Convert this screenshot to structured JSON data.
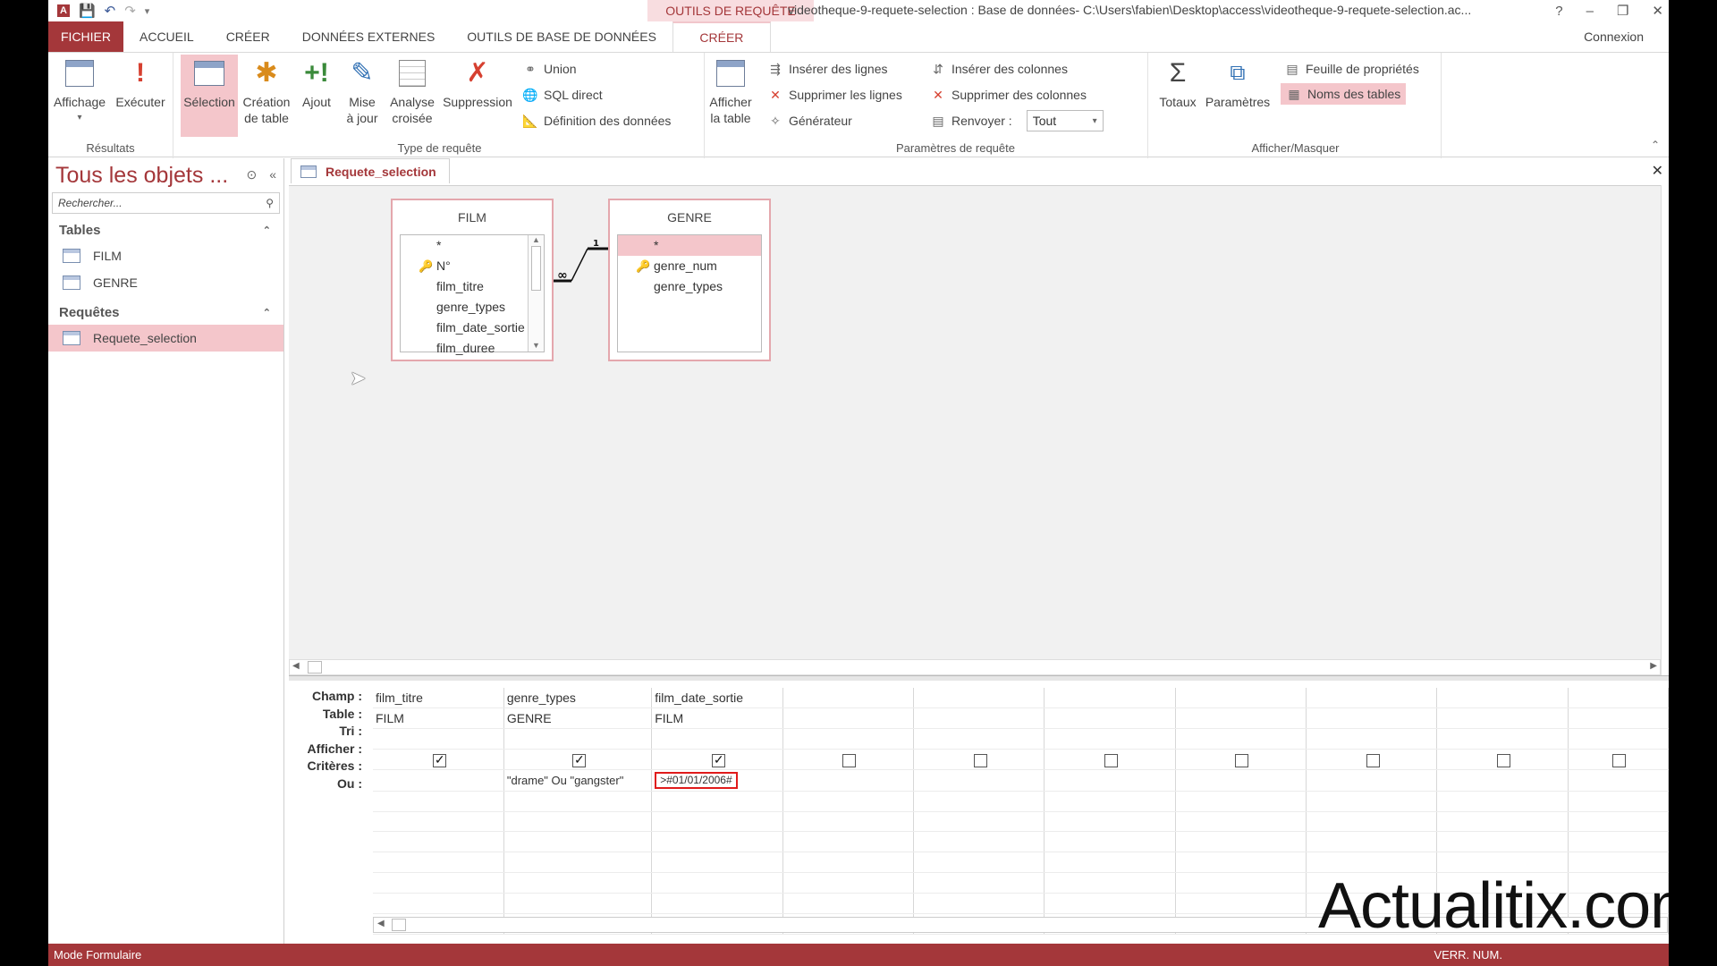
{
  "titlebar": {
    "context_title": "OUTILS DE REQUÊTE",
    "doc_title": "videotheque-9-requete-selection : Base de données- C:\\Users\\fabien\\Desktop\\access\\videotheque-9-requete-selection.ac...",
    "help": "?",
    "minimize": "–",
    "restore": "❐",
    "close": "✕"
  },
  "tabs": {
    "file": "FICHIER",
    "home": "ACCUEIL",
    "create": "CRÉER",
    "external": "DONNÉES EXTERNES",
    "dbtools": "OUTILS DE BASE DE DONNÉES",
    "ctx_create": "CRÉER",
    "connexion": "Connexion"
  },
  "ribbon": {
    "results": {
      "label": "Résultats",
      "view": "Affichage",
      "run": "Exécuter"
    },
    "query_type": {
      "label": "Type de requête",
      "select": "Sélection",
      "make_table_1": "Création",
      "make_table_2": "de table",
      "append": "Ajout",
      "update_1": "Mise",
      "update_2": "à jour",
      "crosstab_1": "Analyse",
      "crosstab_2": "croisée",
      "delete": "Suppression",
      "union": "Union",
      "pass_through": "SQL direct",
      "data_def": "Définition des données"
    },
    "show_table_1": "Afficher",
    "show_table_2": "la table",
    "query_setup": {
      "label": "Paramètres de requête",
      "insert_rows": "Insérer des lignes",
      "delete_rows": "Supprimer les lignes",
      "builder": "Générateur",
      "insert_cols": "Insérer des colonnes",
      "delete_cols": "Supprimer des colonnes",
      "return": "Renvoyer :",
      "return_value": "Tout"
    },
    "show_hide": {
      "label": "Afficher/Masquer",
      "totals": "Totaux",
      "params": "Paramètres",
      "property_sheet": "Feuille de propriétés",
      "table_names": "Noms des tables"
    }
  },
  "nav": {
    "header": "Tous les objets ...",
    "search_placeholder": "Rechercher...",
    "tables_header": "Tables",
    "tables": [
      "FILM",
      "GENRE"
    ],
    "queries_header": "Requêtes",
    "queries": [
      "Requete_selection"
    ]
  },
  "document": {
    "tab_label": "Requete_selection",
    "tables": [
      {
        "name": "FILM",
        "fields": [
          "*",
          "N°",
          "film_titre",
          "genre_types",
          "film_date_sortie",
          "film_duree"
        ]
      },
      {
        "name": "GENRE",
        "fields": [
          "*",
          "genre_num",
          "genre_types"
        ]
      }
    ],
    "relation": {
      "one": "1",
      "many": "∞"
    }
  },
  "grid": {
    "row_labels": [
      "Champ :",
      "Table :",
      "Tri :",
      "Afficher :",
      "Critères :",
      "Ou :"
    ],
    "columns": [
      {
        "field": "film_titre",
        "table": "FILM",
        "show": true,
        "criteria": ""
      },
      {
        "field": "genre_types",
        "table": "GENRE",
        "show": true,
        "criteria": "\"drame\" Ou \"gangster\""
      },
      {
        "field": "film_date_sortie",
        "table": "FILM",
        "show": true,
        "criteria": ">#01/01/2006#"
      },
      {
        "field": "",
        "table": "",
        "show": false,
        "criteria": ""
      },
      {
        "field": "",
        "table": "",
        "show": false,
        "criteria": ""
      },
      {
        "field": "",
        "table": "",
        "show": false,
        "criteria": ""
      },
      {
        "field": "",
        "table": "",
        "show": false,
        "criteria": ""
      },
      {
        "field": "",
        "table": "",
        "show": false,
        "criteria": ""
      },
      {
        "field": "",
        "table": "",
        "show": false,
        "criteria": ""
      },
      {
        "field": "",
        "table": "",
        "show": false,
        "criteria": ""
      }
    ]
  },
  "status": {
    "left": "Mode Formulaire",
    "right": "VERR. NUM."
  },
  "watermark": "Actualitix.com"
}
